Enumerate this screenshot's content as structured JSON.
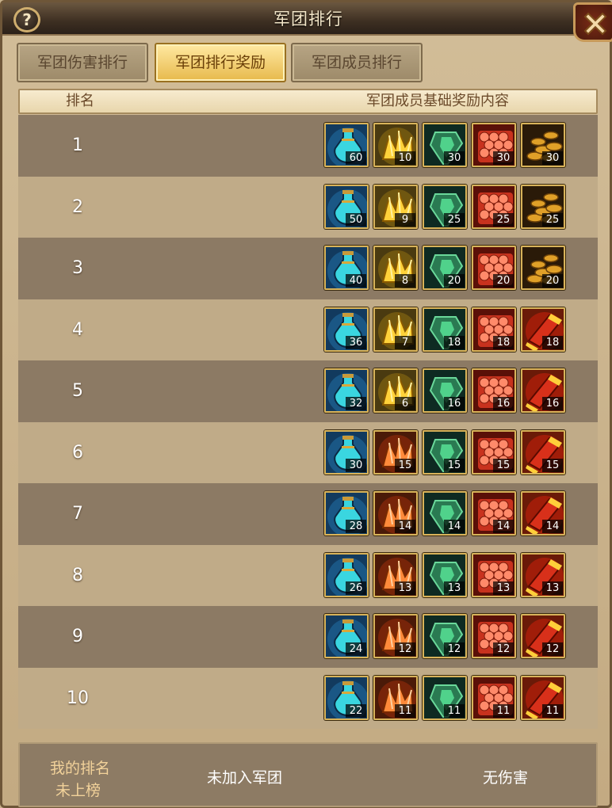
{
  "window": {
    "title": "军团排行"
  },
  "tabs": [
    {
      "label": "军团伤害排行",
      "active": false
    },
    {
      "label": "军团排行奖励",
      "active": true
    },
    {
      "label": "军团成员排行",
      "active": false
    }
  ],
  "table": {
    "col_rank": "排名",
    "col_rewards": "军团成员基础奖励内容",
    "rows": [
      {
        "rank": "1",
        "items": [
          {
            "icon": "potion-icon",
            "qty": "60"
          },
          {
            "icon": "gold-crystal-icon",
            "qty": "10"
          },
          {
            "icon": "green-gem-icon",
            "qty": "30"
          },
          {
            "icon": "red-scale-icon",
            "qty": "30"
          },
          {
            "icon": "gold-coins-icon",
            "qty": "30"
          }
        ]
      },
      {
        "rank": "2",
        "items": [
          {
            "icon": "potion-icon",
            "qty": "50"
          },
          {
            "icon": "gold-crystal-icon",
            "qty": "9"
          },
          {
            "icon": "green-gem-icon",
            "qty": "25"
          },
          {
            "icon": "red-scale-icon",
            "qty": "25"
          },
          {
            "icon": "gold-coins-icon",
            "qty": "25"
          }
        ]
      },
      {
        "rank": "3",
        "items": [
          {
            "icon": "potion-icon",
            "qty": "40"
          },
          {
            "icon": "gold-crystal-icon",
            "qty": "8"
          },
          {
            "icon": "green-gem-icon",
            "qty": "20"
          },
          {
            "icon": "red-scale-icon",
            "qty": "20"
          },
          {
            "icon": "gold-coins-icon",
            "qty": "20"
          }
        ]
      },
      {
        "rank": "4",
        "items": [
          {
            "icon": "potion-icon",
            "qty": "36"
          },
          {
            "icon": "gold-crystal-icon",
            "qty": "7"
          },
          {
            "icon": "green-gem-icon",
            "qty": "18"
          },
          {
            "icon": "red-scale-icon",
            "qty": "18"
          },
          {
            "icon": "red-scroll-icon",
            "qty": "18"
          }
        ]
      },
      {
        "rank": "5",
        "items": [
          {
            "icon": "potion-icon",
            "qty": "32"
          },
          {
            "icon": "gold-crystal-icon",
            "qty": "6"
          },
          {
            "icon": "green-gem-icon",
            "qty": "16"
          },
          {
            "icon": "red-scale-icon",
            "qty": "16"
          },
          {
            "icon": "red-scroll-icon",
            "qty": "16"
          }
        ]
      },
      {
        "rank": "6",
        "items": [
          {
            "icon": "potion-icon",
            "qty": "30"
          },
          {
            "icon": "orange-crystal-icon",
            "qty": "15"
          },
          {
            "icon": "green-gem-icon",
            "qty": "15"
          },
          {
            "icon": "red-scale-icon",
            "qty": "15"
          },
          {
            "icon": "red-scroll-icon",
            "qty": "15"
          }
        ]
      },
      {
        "rank": "7",
        "items": [
          {
            "icon": "potion-icon",
            "qty": "28"
          },
          {
            "icon": "orange-crystal-icon",
            "qty": "14"
          },
          {
            "icon": "green-gem-icon",
            "qty": "14"
          },
          {
            "icon": "red-scale-icon",
            "qty": "14"
          },
          {
            "icon": "red-scroll-icon",
            "qty": "14"
          }
        ]
      },
      {
        "rank": "8",
        "items": [
          {
            "icon": "potion-icon",
            "qty": "26"
          },
          {
            "icon": "orange-crystal-icon",
            "qty": "13"
          },
          {
            "icon": "green-gem-icon",
            "qty": "13"
          },
          {
            "icon": "red-scale-icon",
            "qty": "13"
          },
          {
            "icon": "red-scroll-icon",
            "qty": "13"
          }
        ]
      },
      {
        "rank": "9",
        "items": [
          {
            "icon": "potion-icon",
            "qty": "24"
          },
          {
            "icon": "orange-crystal-icon",
            "qty": "12"
          },
          {
            "icon": "green-gem-icon",
            "qty": "12"
          },
          {
            "icon": "red-scale-icon",
            "qty": "12"
          },
          {
            "icon": "red-scroll-icon",
            "qty": "12"
          }
        ]
      },
      {
        "rank": "10",
        "items": [
          {
            "icon": "potion-icon",
            "qty": "22"
          },
          {
            "icon": "orange-crystal-icon",
            "qty": "11"
          },
          {
            "icon": "green-gem-icon",
            "qty": "11"
          },
          {
            "icon": "red-scale-icon",
            "qty": "11"
          },
          {
            "icon": "red-scroll-icon",
            "qty": "11"
          }
        ]
      }
    ]
  },
  "footer": {
    "my_rank_label": "我的排名",
    "my_rank_value": "未上榜",
    "guild_status": "未加入军团",
    "damage_status": "无伤害"
  },
  "colors": {
    "row_dark": "#8c7a64",
    "row_light": "#c0ab88",
    "tab_active": "#e7b94c",
    "item_border": "#d8b35a"
  }
}
